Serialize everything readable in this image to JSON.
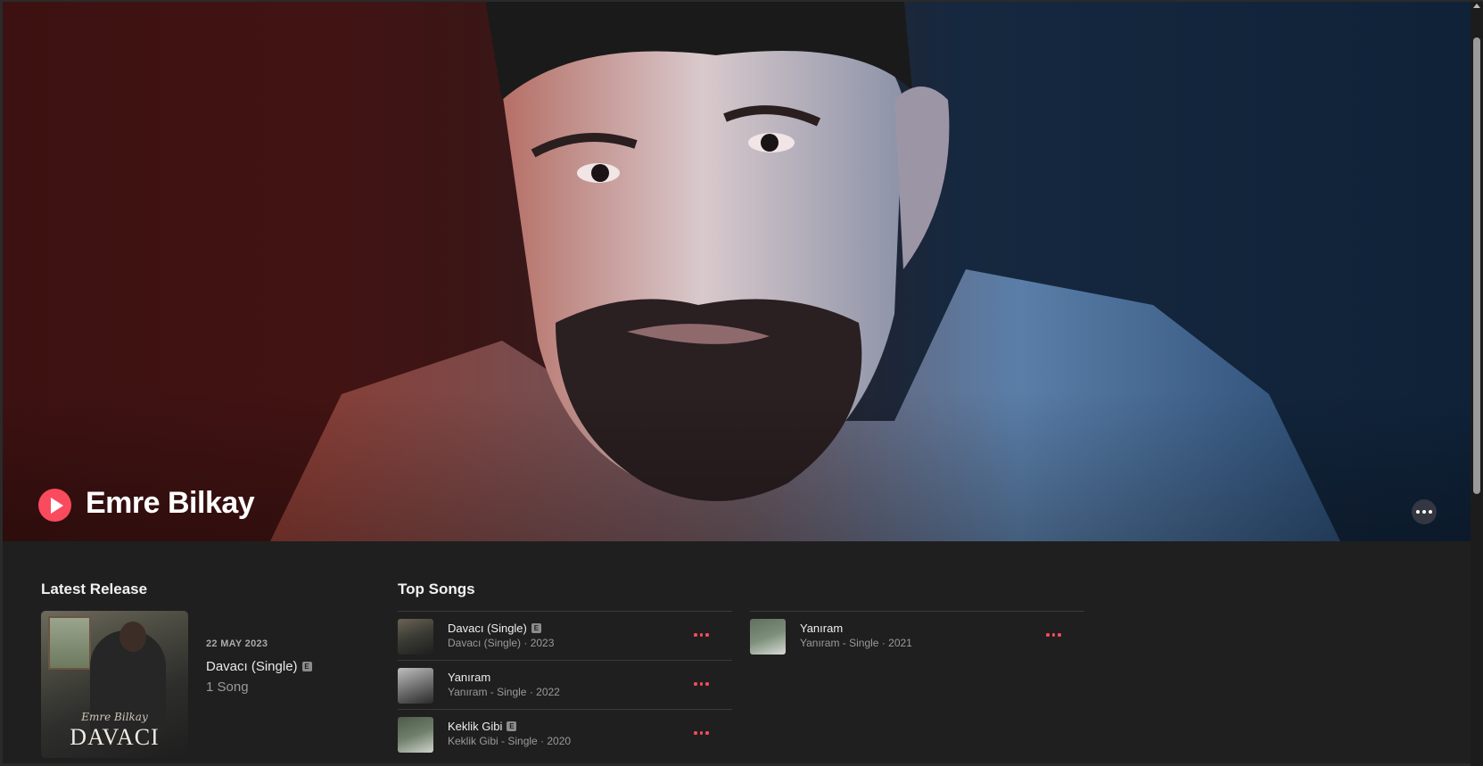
{
  "artist": {
    "name": "Emre Bilkay"
  },
  "latest_release": {
    "heading": "Latest Release",
    "date": "22 MAY 2023",
    "title": "Davacı (Single)",
    "explicit_badge": "E",
    "count": "1 Song",
    "artwork": {
      "script": "Emre Bilkay",
      "title": "DAVACI"
    }
  },
  "top_songs": {
    "heading": "Top Songs",
    "columns": [
      [
        {
          "title": "Davacı (Single)",
          "explicit": "E",
          "subtitle": "Davacı (Single) · 2023"
        },
        {
          "title": "Yanıram",
          "explicit": "",
          "subtitle": "Yanıram - Single · 2022"
        },
        {
          "title": "Keklik Gibi",
          "explicit": "E",
          "subtitle": "Keklik Gibi - Single · 2020"
        }
      ],
      [
        {
          "title": "Yanıram",
          "explicit": "",
          "subtitle": "Yanıram - Single · 2021"
        }
      ]
    ]
  },
  "colors": {
    "accent": "#fa4a5e",
    "background": "#1f1f1f",
    "hero_left": "#421313",
    "hero_right": "#0f2238"
  },
  "icons": {
    "play": "play-icon",
    "more": "ellipsis-icon"
  }
}
